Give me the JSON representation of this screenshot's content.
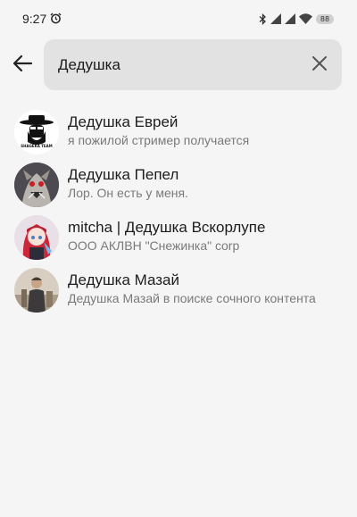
{
  "status_bar": {
    "time": "9:27",
    "battery": "88",
    "icons": [
      "alarm-icon",
      "bluetooth-icon",
      "signal-icon",
      "signal-icon",
      "wifi-icon",
      "battery-icon"
    ]
  },
  "search": {
    "value": "Дедушка",
    "back_icon": "arrow-left-icon",
    "clear_icon": "close-icon"
  },
  "results": [
    {
      "title": "Дедушка Еврей",
      "subtitle": "я пожилой стример получается",
      "avatar_text": "SHAGEKA TEAM",
      "avatar_bg": "#ffffff"
    },
    {
      "title": "Дедушка Пепел",
      "subtitle": "Лор. Он есть у меня.",
      "avatar_bg": "#3a3a44"
    },
    {
      "title": "mitcha | Дедушка Вскорлупе",
      "subtitle": "ООО АКЛВН \"Снежинка\" corp",
      "avatar_bg": "#e9dfe6"
    },
    {
      "title": "Дедушка Мазай",
      "subtitle": "Дедушка Мазай в поиске сочного контента",
      "avatar_bg": "#c9b79c"
    }
  ],
  "colors": {
    "background": "#f5f5f5",
    "search_bg": "#e2e2e2",
    "title": "#1d1d1d",
    "subtitle": "#7a7a7a"
  }
}
